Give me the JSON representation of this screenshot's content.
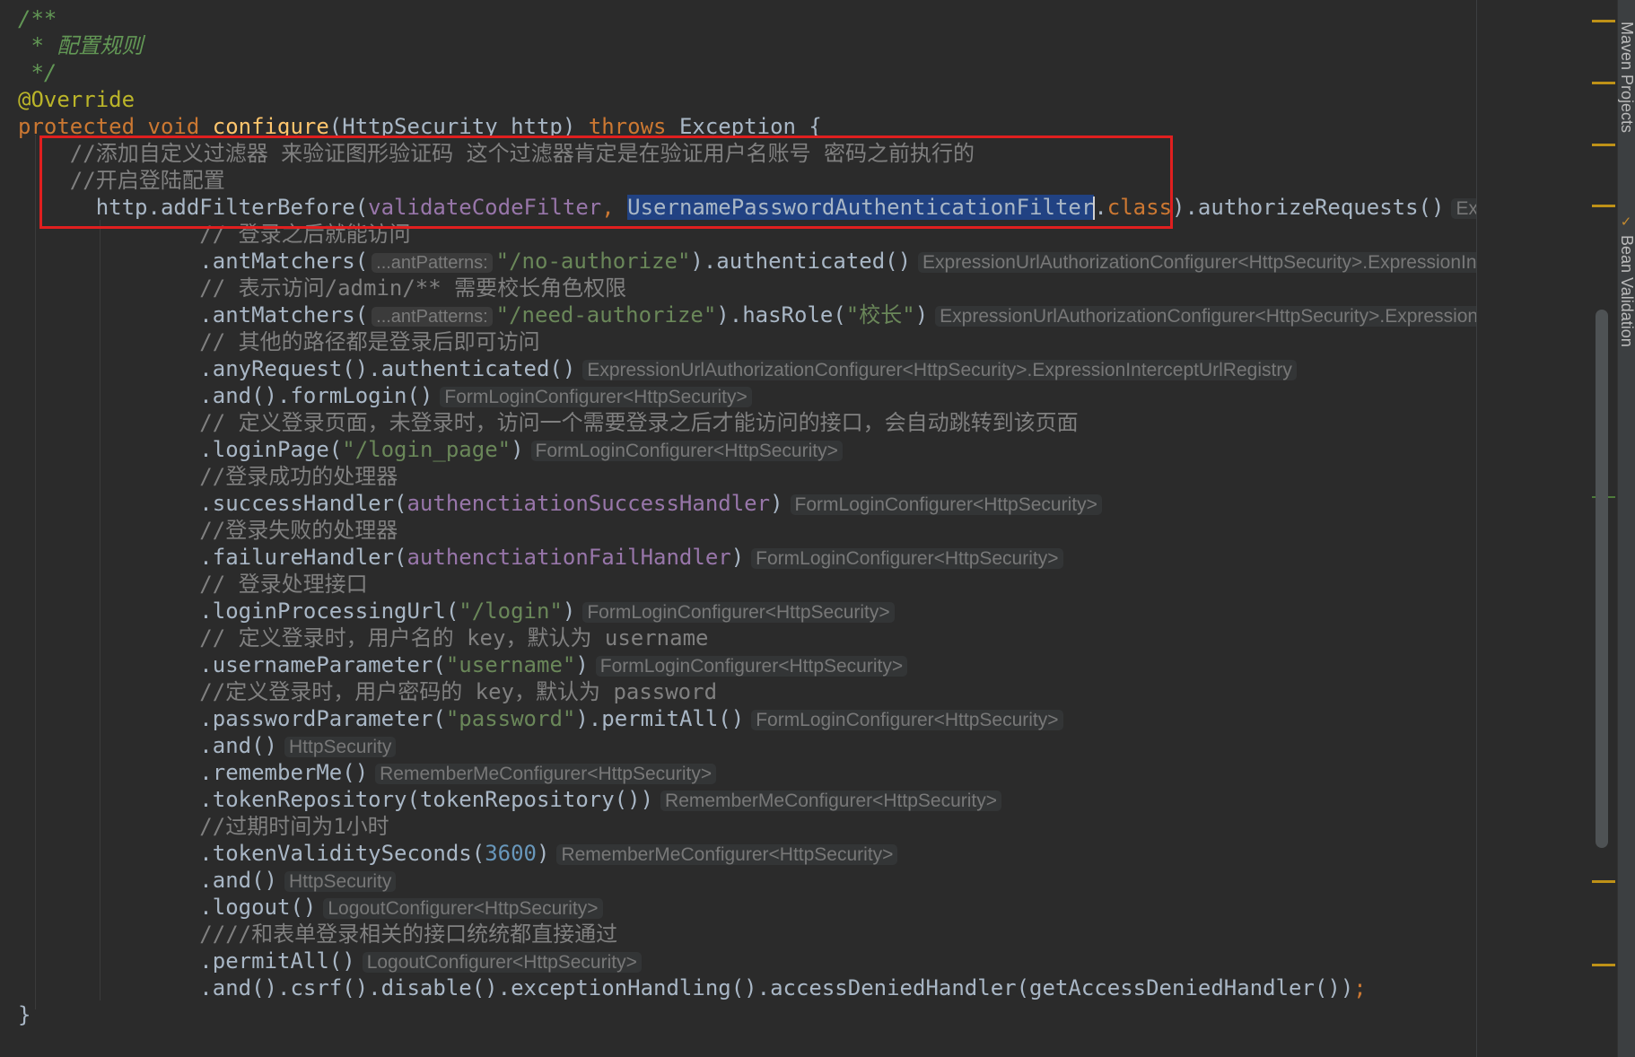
{
  "editor": {
    "lines": [
      {
        "indent": "",
        "tokens": [
          {
            "t": "doc",
            "v": "/**"
          }
        ]
      },
      {
        "indent": "",
        "tokens": [
          {
            "t": "doc",
            "v": " * 配置规则"
          }
        ]
      },
      {
        "indent": "",
        "tokens": [
          {
            "t": "doc",
            "v": " */"
          }
        ]
      },
      {
        "indent": "",
        "tokens": [
          {
            "t": "ann",
            "v": "@Override"
          }
        ]
      },
      {
        "indent": "",
        "tokens": [
          {
            "t": "kw",
            "v": "protected "
          },
          {
            "t": "kw",
            "v": "void "
          },
          {
            "t": "method",
            "v": "configure"
          },
          {
            "t": "plain",
            "v": "(HttpSecurity http) "
          },
          {
            "t": "kw",
            "v": "throws "
          },
          {
            "t": "plain",
            "v": "Exception {"
          }
        ]
      },
      {
        "indent": "    ",
        "tokens": [
          {
            "t": "cmt",
            "v": "//添加自定义过滤器 来验证图形验证码 这个过滤器肯定是在验证用户名账号 密码之前执行的"
          }
        ]
      },
      {
        "indent": "    ",
        "tokens": [
          {
            "t": "cmt",
            "v": "//开启登陆配置"
          }
        ]
      },
      {
        "indent": "      ",
        "tokens": [
          {
            "t": "plain",
            "v": "http.addFilterBefore("
          },
          {
            "t": "field",
            "v": "validateCodeFilter"
          },
          {
            "t": "kw",
            "v": ", "
          },
          {
            "t": "sel",
            "v": "UsernamePasswordAuthenticationFilter"
          },
          {
            "t": "caret",
            "v": ""
          },
          {
            "t": "plain",
            "v": "."
          },
          {
            "t": "kw",
            "v": "class"
          },
          {
            "t": "plain",
            "v": ").authorizeRequests()"
          },
          {
            "t": "hint",
            "v": "ExpressionInterceptU"
          }
        ]
      },
      {
        "indent": "              ",
        "tokens": [
          {
            "t": "cmt",
            "v": "// 登录之后就能访问"
          }
        ]
      },
      {
        "indent": "              ",
        "tokens": [
          {
            "t": "plain",
            "v": ".antMatchers("
          },
          {
            "t": "param",
            "v": "...antPatterns:"
          },
          {
            "t": "str",
            "v": "\"/no-authorize\""
          },
          {
            "t": "plain",
            "v": ").authenticated()"
          },
          {
            "t": "hint",
            "v": "ExpressionUrlAuthorizationConfigurer<HttpSecurity>.ExpressionInterceptUrlR"
          }
        ]
      },
      {
        "indent": "              ",
        "tokens": [
          {
            "t": "cmt",
            "v": "// 表示访问/admin/** 需要校长角色权限"
          }
        ]
      },
      {
        "indent": "              ",
        "tokens": [
          {
            "t": "plain",
            "v": ".antMatchers("
          },
          {
            "t": "param",
            "v": "...antPatterns:"
          },
          {
            "t": "str",
            "v": "\"/need-authorize\""
          },
          {
            "t": "plain",
            "v": ").hasRole("
          },
          {
            "t": "str",
            "v": "\"校长\""
          },
          {
            "t": "plain",
            "v": ")"
          },
          {
            "t": "hint",
            "v": "ExpressionUrlAuthorizationConfigurer<HttpSecurity>.ExpressionIntercept"
          }
        ]
      },
      {
        "indent": "              ",
        "tokens": [
          {
            "t": "cmt",
            "v": "// 其他的路径都是登录后即可访问"
          }
        ]
      },
      {
        "indent": "              ",
        "tokens": [
          {
            "t": "plain",
            "v": ".anyRequest().authenticated()"
          },
          {
            "t": "hint",
            "v": "ExpressionUrlAuthorizationConfigurer<HttpSecurity>.ExpressionInterceptUrlRegistry"
          }
        ]
      },
      {
        "indent": "              ",
        "tokens": [
          {
            "t": "plain",
            "v": ".and().formLogin()"
          },
          {
            "t": "hint",
            "v": "FormLoginConfigurer<HttpSecurity>"
          }
        ]
      },
      {
        "indent": "              ",
        "tokens": [
          {
            "t": "cmt",
            "v": "// 定义登录页面，未登录时，访问一个需要登录之后才能访问的接口，会自动跳转到该页面"
          }
        ]
      },
      {
        "indent": "              ",
        "tokens": [
          {
            "t": "plain",
            "v": ".loginPage("
          },
          {
            "t": "str",
            "v": "\"/login_page\""
          },
          {
            "t": "plain",
            "v": ")"
          },
          {
            "t": "hint",
            "v": "FormLoginConfigurer<HttpSecurity>"
          }
        ]
      },
      {
        "indent": "              ",
        "tokens": [
          {
            "t": "cmt",
            "v": "//登录成功的处理器"
          }
        ]
      },
      {
        "indent": "              ",
        "tokens": [
          {
            "t": "plain",
            "v": ".successHandler("
          },
          {
            "t": "field",
            "v": "authenctiationSuccessHandler"
          },
          {
            "t": "plain",
            "v": ")"
          },
          {
            "t": "hint",
            "v": "FormLoginConfigurer<HttpSecurity>"
          }
        ]
      },
      {
        "indent": "              ",
        "tokens": [
          {
            "t": "cmt",
            "v": "//登录失败的处理器"
          }
        ]
      },
      {
        "indent": "              ",
        "tokens": [
          {
            "t": "plain",
            "v": ".failureHandler("
          },
          {
            "t": "field",
            "v": "authenctiationFailHandler"
          },
          {
            "t": "plain",
            "v": ")"
          },
          {
            "t": "hint",
            "v": "FormLoginConfigurer<HttpSecurity>"
          }
        ]
      },
      {
        "indent": "              ",
        "tokens": [
          {
            "t": "cmt",
            "v": "// 登录处理接口"
          }
        ]
      },
      {
        "indent": "              ",
        "tokens": [
          {
            "t": "plain",
            "v": ".loginProcessingUrl("
          },
          {
            "t": "str",
            "v": "\"/login\""
          },
          {
            "t": "plain",
            "v": ")"
          },
          {
            "t": "hint",
            "v": "FormLoginConfigurer<HttpSecurity>"
          }
        ]
      },
      {
        "indent": "              ",
        "tokens": [
          {
            "t": "cmt",
            "v": "// 定义登录时，用户名的 key，默认为 username"
          }
        ]
      },
      {
        "indent": "              ",
        "tokens": [
          {
            "t": "plain",
            "v": ".usernameParameter("
          },
          {
            "t": "str",
            "v": "\"username\""
          },
          {
            "t": "plain",
            "v": ")"
          },
          {
            "t": "hint",
            "v": "FormLoginConfigurer<HttpSecurity>"
          }
        ]
      },
      {
        "indent": "              ",
        "tokens": [
          {
            "t": "cmt",
            "v": "//定义登录时，用户密码的 key，默认为 password"
          }
        ]
      },
      {
        "indent": "              ",
        "tokens": [
          {
            "t": "plain",
            "v": ".passwordParameter("
          },
          {
            "t": "str",
            "v": "\"password\""
          },
          {
            "t": "plain",
            "v": ").permitAll()"
          },
          {
            "t": "hint",
            "v": "FormLoginConfigurer<HttpSecurity>"
          }
        ]
      },
      {
        "indent": "              ",
        "tokens": [
          {
            "t": "plain",
            "v": ".and()"
          },
          {
            "t": "hint",
            "v": "HttpSecurity"
          }
        ]
      },
      {
        "indent": "              ",
        "tokens": [
          {
            "t": "plain",
            "v": ".rememberMe()"
          },
          {
            "t": "hint",
            "v": "RememberMeConfigurer<HttpSecurity>"
          }
        ]
      },
      {
        "indent": "              ",
        "tokens": [
          {
            "t": "plain",
            "v": ".tokenRepository(tokenRepository())"
          },
          {
            "t": "hint",
            "v": "RememberMeConfigurer<HttpSecurity>"
          }
        ]
      },
      {
        "indent": "              ",
        "tokens": [
          {
            "t": "cmt",
            "v": "//过期时间为1小时"
          }
        ]
      },
      {
        "indent": "              ",
        "tokens": [
          {
            "t": "plain",
            "v": ".tokenValiditySeconds("
          },
          {
            "t": "num",
            "v": "3600"
          },
          {
            "t": "plain",
            "v": ")"
          },
          {
            "t": "hint",
            "v": "RememberMeConfigurer<HttpSecurity>"
          }
        ]
      },
      {
        "indent": "              ",
        "tokens": [
          {
            "t": "plain",
            "v": ".and()"
          },
          {
            "t": "hint",
            "v": "HttpSecurity"
          }
        ]
      },
      {
        "indent": "              ",
        "tokens": [
          {
            "t": "plain",
            "v": ".logout()"
          },
          {
            "t": "hint",
            "v": "LogoutConfigurer<HttpSecurity>"
          }
        ]
      },
      {
        "indent": "              ",
        "tokens": [
          {
            "t": "cmt",
            "v": "////和表单登录相关的接口统统都直接通过"
          }
        ]
      },
      {
        "indent": "              ",
        "tokens": [
          {
            "t": "plain",
            "v": ".permitAll()"
          },
          {
            "t": "hint",
            "v": "LogoutConfigurer<HttpSecurity>"
          }
        ]
      },
      {
        "indent": "              ",
        "tokens": [
          {
            "t": "plain",
            "v": ".and().csrf().disable().exceptionHandling().accessDeniedHandler(getAccessDeniedHandler())"
          },
          {
            "t": "kw",
            "v": ";"
          }
        ]
      },
      {
        "indent": "",
        "tokens": [
          {
            "t": "plain",
            "v": "}"
          }
        ]
      }
    ]
  },
  "tool_windows": [
    {
      "name": "maven",
      "label": "Maven Projects"
    },
    {
      "name": "bean-validation",
      "label": "Bean Validation"
    }
  ],
  "colors": {
    "background": "#2b2b2b",
    "highlight_box": "#e01f1f",
    "selection": "#214283"
  }
}
